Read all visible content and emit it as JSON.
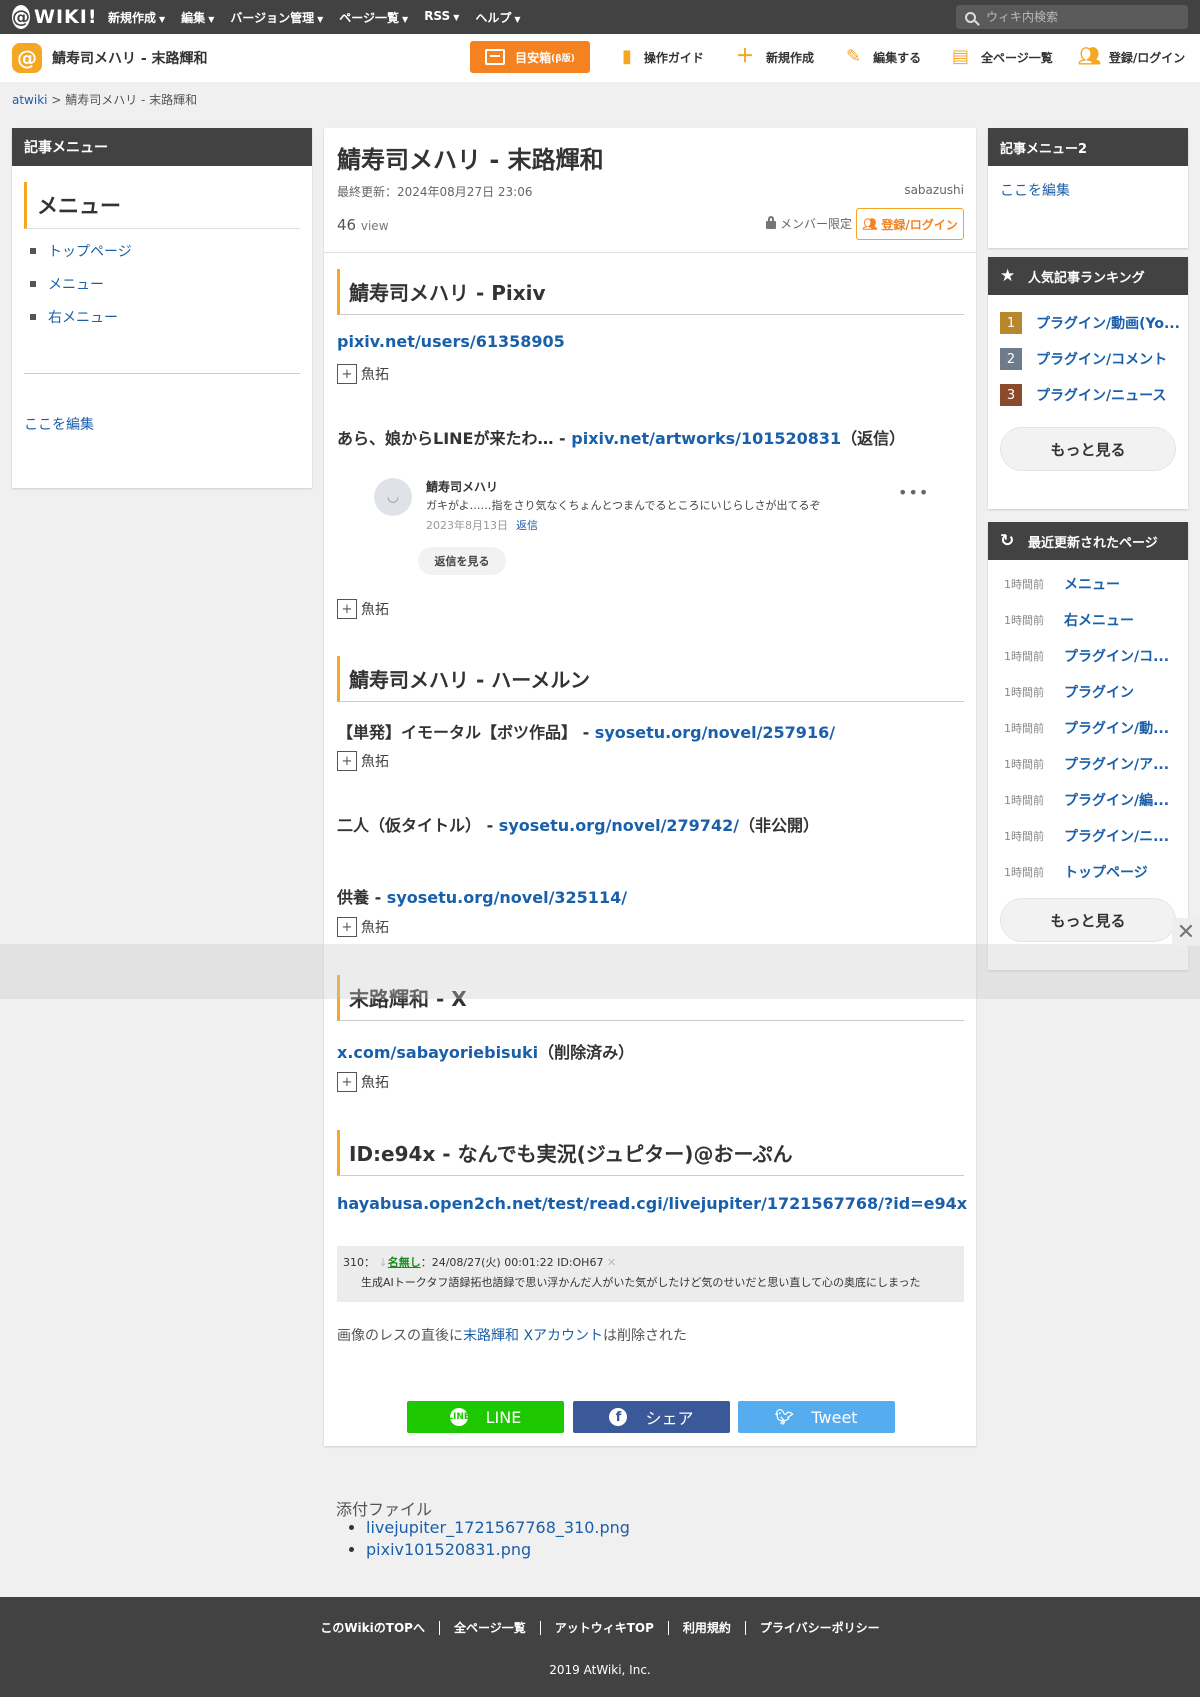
{
  "topbar": {
    "logo": "WIKI!",
    "menu": [
      "新規作成",
      "編集",
      "バージョン管理",
      "ページ一覧",
      "RSS",
      "ヘルプ"
    ],
    "search_placeholder": "ウィキ内検索"
  },
  "header": {
    "site_title": "鯖寿司メハリ - 末路輝和",
    "meyasu_label": "目安箱",
    "meyasu_sub": "(β版)",
    "links": [
      "操作ガイド",
      "新規作成",
      "編集する",
      "全ページ一覧",
      "登録/ログイン"
    ]
  },
  "breadcrumb": {
    "root": "atwiki",
    "sep": " > ",
    "current": "鯖寿司メハリ - 末路輝和"
  },
  "left_menu": {
    "head": "記事メニュー",
    "title": "メニュー",
    "items": [
      "トップページ",
      "メニュー",
      "右メニュー"
    ],
    "edit": "ここを編集"
  },
  "main": {
    "title": "鯖寿司メハリ - 末路輝和",
    "updated": "最終更新：2024年08月27日 23:06",
    "author": "sabazushi",
    "views": "46",
    "views_unit": "view",
    "member_only": "メンバー限定",
    "login_btn": "登録/ログイン",
    "gyotaku": "魚拓",
    "sections": [
      "鯖寿司メハリ - Pixiv",
      "鯖寿司メハリ - ハーメルン",
      "末路輝和 - X",
      "ID:e94x - なんでも実況(ジュピター)@おーぷん"
    ],
    "pixiv_link": "pixiv.net/users/61358905",
    "line_msg_prefix": "あら、娘からLINEが来たわ… - ",
    "line_msg_link": "pixiv.net/artworks/101520831",
    "line_msg_suffix": "（返信）",
    "comment": {
      "name": "鯖寿司メハリ",
      "text": "ガキがよ……指をさり気なくちょんとつまんでるところにいじらしさが出てるぞ",
      "date": "2023年8月13日",
      "reply": "返信",
      "view_replies": "返信を見る"
    },
    "hameln1_prefix": "【単発】イモータル【ボツ作品】 - ",
    "hameln1_link": "syosetu.org/novel/257916/",
    "hameln2_prefix": "二人（仮タイトル） - ",
    "hameln2_link": "syosetu.org/novel/279742/",
    "hameln2_suffix": "（非公開）",
    "hameln3_prefix": "供養 - ",
    "hameln3_link": "syosetu.org/novel/325114/",
    "x_link": "x.com/sabayoriebisuki",
    "x_suffix": "（削除済み）",
    "open2ch_link": "hayabusa.open2ch.net/test/read.cgi/livejupiter/1721567768/?id=e94x",
    "post": {
      "num": "310：",
      "name": "名無し",
      "meta": "：24/08/27(火) 00:01:22 ID:OH67",
      "body": "生成AIトークタフ語録拓也語録で思い浮かんだ人がいた気がしたけど気のせいだと思い直して心の奥底にしまった"
    },
    "note_prefix": "画像のレスの直後に",
    "note_link": "末路輝和 Xアカウント",
    "note_suffix": "は削除された",
    "share": [
      {
        "label": "LINE",
        "color": "#1ec800"
      },
      {
        "label": "シェア",
        "color": "#3b5998"
      },
      {
        "label": "Tweet",
        "color": "#55acee"
      }
    ]
  },
  "attachments": {
    "title": "添付ファイル",
    "files": [
      "livejupiter_1721567768_310.png",
      "pixiv101520831.png"
    ]
  },
  "right": {
    "menu2_head": "記事メニュー2",
    "menu2_edit": "ここを編集",
    "ranking_head": "人気記事ランキング",
    "ranking": [
      {
        "num": "1",
        "title": "プラグイン/動画(Yo...",
        "color": "#b8862b"
      },
      {
        "num": "2",
        "title": "プラグイン/コメント",
        "color": "#6e7b8b"
      },
      {
        "num": "3",
        "title": "プラグイン/ニュース",
        "color": "#8b4a2b"
      }
    ],
    "more": "もっと見る",
    "recent_head": "最近更新されたページ",
    "recent": [
      {
        "time": "1時間前",
        "title": "メニュー"
      },
      {
        "time": "1時間前",
        "title": "右メニュー"
      },
      {
        "time": "1時間前",
        "title": "プラグイン/コ..."
      },
      {
        "time": "1時間前",
        "title": "プラグイン"
      },
      {
        "time": "1時間前",
        "title": "プラグイン/動..."
      },
      {
        "time": "1時間前",
        "title": "プラグイン/ア..."
      },
      {
        "time": "1時間前",
        "title": "プラグイン/編..."
      },
      {
        "time": "1時間前",
        "title": "プラグイン/ニ..."
      },
      {
        "time": "1時間前",
        "title": "トップページ"
      }
    ]
  },
  "footer": {
    "links": [
      "このWikiのTOPへ",
      "全ページ一覧",
      "アットウィキTOP",
      "利用規約",
      "プライバシーポリシー"
    ],
    "copyright": "2019 AtWiki, Inc."
  },
  "colors": {
    "accent": "#f5a623",
    "header_bg": "#424242",
    "link": "#1a5faa"
  }
}
